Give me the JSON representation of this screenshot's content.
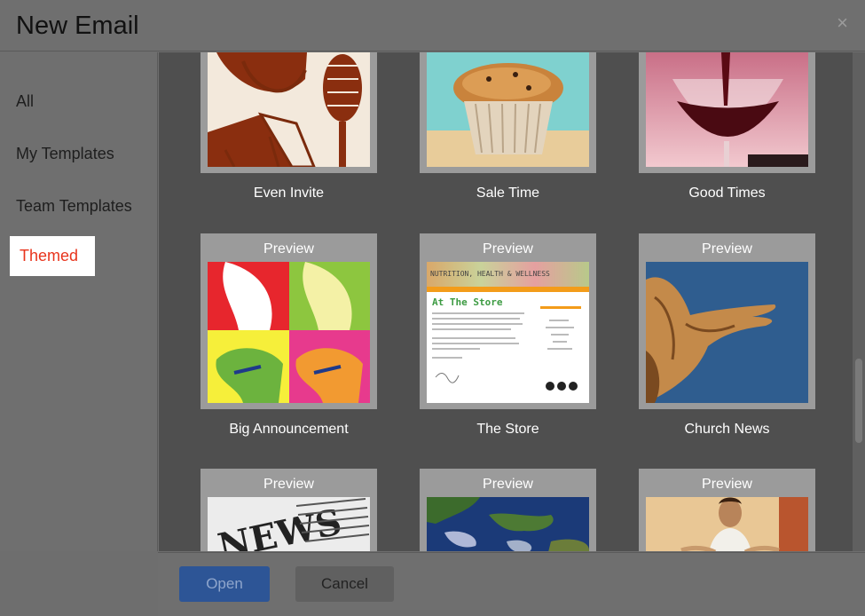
{
  "dialog": {
    "title": "New Email",
    "close_glyph": "×"
  },
  "sidebar": {
    "items": [
      {
        "label": "All",
        "active": false
      },
      {
        "label": "My Templates",
        "active": false
      },
      {
        "label": "Team Templates",
        "active": false
      },
      {
        "label": "Themed",
        "active": true
      }
    ]
  },
  "templates": {
    "preview_label": "Preview",
    "cards": [
      {
        "name": "Even Invite",
        "image_icon": "retro-man-microphone-image"
      },
      {
        "name": "Sale Time",
        "image_icon": "muffin-image"
      },
      {
        "name": "Good Times",
        "image_icon": "wine-glass-image"
      },
      {
        "name": "Big Announcement",
        "image_icon": "pop-art-portrait-image"
      },
      {
        "name": "The Store",
        "image_icon": "newsletter-store-image"
      },
      {
        "name": "Church News",
        "image_icon": "statue-hand-image"
      },
      {
        "name": "",
        "image_icon": "newspaper-image"
      },
      {
        "name": "",
        "image_icon": "earth-satellite-image"
      },
      {
        "name": "",
        "image_icon": "yoga-woman-image"
      }
    ],
    "store_thumb": {
      "banner": "NUTRITION, HEALTH & WELLNESS",
      "heading": "At The Store"
    }
  },
  "footer": {
    "open_label": "Open",
    "cancel_label": "Cancel"
  },
  "colors": {
    "active_tab_text": "#e8341c",
    "primary_button": "#2d5596",
    "content_bg": "#4f4f4f"
  }
}
